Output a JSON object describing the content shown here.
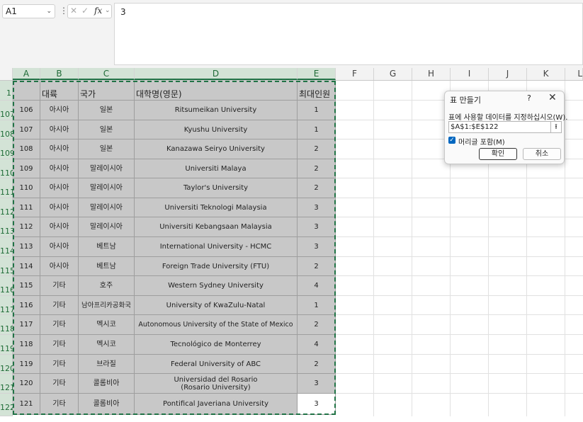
{
  "formula_bar": {
    "name_box": "A1",
    "formula_value": "3",
    "fx_label": "fx"
  },
  "columns": [
    "A",
    "B",
    "C",
    "D",
    "E",
    "F",
    "G",
    "H",
    "I",
    "J",
    "K",
    "L"
  ],
  "header_row": {
    "row_number": "1",
    "cells": [
      "",
      "대륙",
      "국가",
      "대학명(영문)",
      "최대인원"
    ]
  },
  "rows": [
    {
      "row_number": "107",
      "cells": [
        "106",
        "아시아",
        "일본",
        "Ritsumeikan University",
        "1"
      ]
    },
    {
      "row_number": "108",
      "cells": [
        "107",
        "아시아",
        "일본",
        "Kyushu University",
        "1"
      ]
    },
    {
      "row_number": "109",
      "cells": [
        "108",
        "아시아",
        "일본",
        "Kanazawa Seiryo University",
        "2"
      ]
    },
    {
      "row_number": "110",
      "cells": [
        "109",
        "아시아",
        "말레이시아",
        "Universiti Malaya",
        "2"
      ]
    },
    {
      "row_number": "111",
      "cells": [
        "110",
        "아시아",
        "말레이시아",
        "Taylor's University",
        "2"
      ]
    },
    {
      "row_number": "112",
      "cells": [
        "111",
        "아시아",
        "말레이시아",
        "Universiti Teknologi Malaysia",
        "3"
      ]
    },
    {
      "row_number": "113",
      "cells": [
        "112",
        "아시아",
        "말레이시아",
        "Universiti Kebangsaan Malaysia",
        "3"
      ]
    },
    {
      "row_number": "114",
      "cells": [
        "113",
        "아시아",
        "베트남",
        "International University - HCMC",
        "3"
      ]
    },
    {
      "row_number": "115",
      "cells": [
        "114",
        "아시아",
        "베트남",
        "Foreign Trade University (FTU)",
        "2"
      ]
    },
    {
      "row_number": "116",
      "cells": [
        "115",
        "기타",
        "호주",
        "Western Sydney University",
        "4"
      ]
    },
    {
      "row_number": "117",
      "cells": [
        "116",
        "기타",
        "남아프리카공화국",
        "University of KwaZulu-Natal",
        "1"
      ]
    },
    {
      "row_number": "118",
      "cells": [
        "117",
        "기타",
        "멕시코",
        "Autonomous University of the State of Mexico",
        "2"
      ]
    },
    {
      "row_number": "119",
      "cells": [
        "118",
        "기타",
        "멕시코",
        "Tecnológico de Monterrey",
        "4"
      ]
    },
    {
      "row_number": "120",
      "cells": [
        "119",
        "기타",
        "브라질",
        "Federal University of ABC",
        "2"
      ]
    },
    {
      "row_number": "121",
      "cells": [
        "120",
        "기타",
        "콜롬비아",
        "Universidad del Rosario\n(Rosario University)",
        "3"
      ]
    },
    {
      "row_number": "122",
      "cells": [
        "121",
        "기타",
        "콜롬비아",
        "Pontifical Javeriana University",
        "3"
      ]
    }
  ],
  "dialog": {
    "title": "표 만들기",
    "help": "?",
    "close": "✕",
    "prompt": "표에 사용할 데이터를 지정하십시오(W).",
    "range_value": "$A$1:$E$122",
    "checkbox_label": "머리글 포함(M)",
    "checkbox_checked": true,
    "ok_label": "확인",
    "cancel_label": "취소"
  },
  "colors": {
    "selection_green": "#217346",
    "table_fill": "#c8c8c8"
  }
}
